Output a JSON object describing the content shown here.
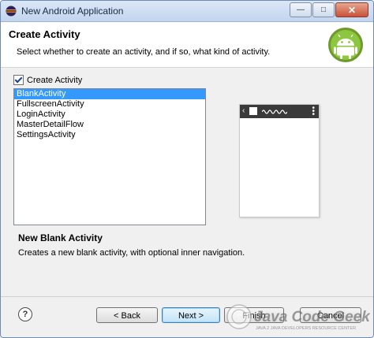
{
  "window": {
    "title": "New Android Application"
  },
  "banner": {
    "heading": "Create Activity",
    "subheading": "Select whether to create an activity, and if so, what kind of activity."
  },
  "create_activity_checkbox": {
    "label": "Create Activity",
    "checked": true
  },
  "activity_list": {
    "items": [
      {
        "label": "BlankActivity",
        "selected": true
      },
      {
        "label": "FullscreenActivity",
        "selected": false
      },
      {
        "label": "LoginActivity",
        "selected": false
      },
      {
        "label": "MasterDetailFlow",
        "selected": false
      },
      {
        "label": "SettingsActivity",
        "selected": false
      }
    ]
  },
  "description": {
    "title": "New Blank Activity",
    "text": "Creates a new blank activity, with optional inner navigation."
  },
  "buttons": {
    "back": "< Back",
    "next": "Next >",
    "finish": "Finish",
    "cancel": "Cancel"
  },
  "watermark": {
    "brand": "Java Code Geeks",
    "tagline": "JAVA 2 JAVA DEVELOPERS RESOURCE CENTER"
  },
  "colors": {
    "selection": "#3399ff",
    "android_green": "#8dc63f",
    "logo_ring": "#6d9a2a"
  },
  "icons": {
    "app": "eclipse-icon",
    "logo": "android-robot-icon",
    "help": "help-icon"
  }
}
